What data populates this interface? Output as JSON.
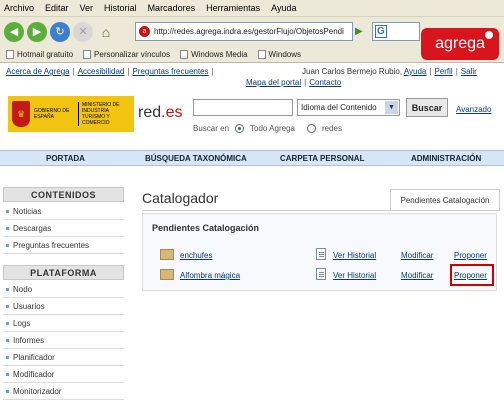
{
  "browser": {
    "menu": [
      "Archivo",
      "Editar",
      "Ver",
      "Historial",
      "Marcadores",
      "Herramientas",
      "Ayuda"
    ],
    "url": "http://redes.agrega.indra.es/gestorFlujo/ObjetosPendi",
    "search_placeholder": "Go",
    "search_engine_icon": "G",
    "bookmarks": [
      "Hotmail gratuito",
      "Personalizar vínculos",
      "Windows Media",
      "Windows"
    ],
    "badge_text": "agrega"
  },
  "header": {
    "links": [
      "Acerca de Agrega",
      "Accesibilidad",
      "Preguntas frecuentes"
    ],
    "user_name": "Juan Carlos Bermejo Rubio,",
    "user_links": [
      "Ayuda",
      "Perfil",
      "Salir"
    ],
    "links2": [
      "Mapa del portal",
      "Contacto"
    ],
    "gov_text_1": "GOBIERNO DE ESPAÑA",
    "gov_text_2": "MINISTERIO DE INDUSTRIA TURISMO Y COMERCIO",
    "brand": "red",
    "brand_suffix": ".es"
  },
  "search": {
    "select_value": "Idioma del Contenido",
    "button_label": "Buscar",
    "advanced_label": "Avanzado",
    "buscar_en_label": "Buscar en",
    "option_1": "Todo Agrega",
    "option_2": "redes"
  },
  "nav": [
    "PORTADA",
    "BÚSQUEDA TAXONÓMICA",
    "CARPETA PERSONAL",
    "ADMINISTRACIÓN"
  ],
  "sidebar": {
    "contenidos_title": "CONTENIDOS",
    "contenidos": [
      "Noticias",
      "Descargas",
      "Preguntas frecuentes"
    ],
    "plataforma_title": "PLATAFORMA",
    "plataforma": [
      "Nodo",
      "Usuarios",
      "Logs",
      "Informes",
      "Planificador",
      "Modificador",
      "Monitorizador"
    ]
  },
  "main": {
    "title": "Catalogador",
    "tab": "Pendientes Catalogación",
    "panel_title": "Pendientes Catalogación",
    "rows": [
      {
        "name": "enchufes",
        "history": "Ver Historial",
        "modify": "Modificar",
        "propose": "Proponer"
      },
      {
        "name": "Alfombra mágica",
        "history": "Ver Historial",
        "modify": "Modificar",
        "propose": "Proponer"
      }
    ]
  },
  "colors": {
    "accent": "#d8141d",
    "nav_bg": "#d6e6f6",
    "link": "#0b3a7a",
    "highlight": "#d10000"
  }
}
